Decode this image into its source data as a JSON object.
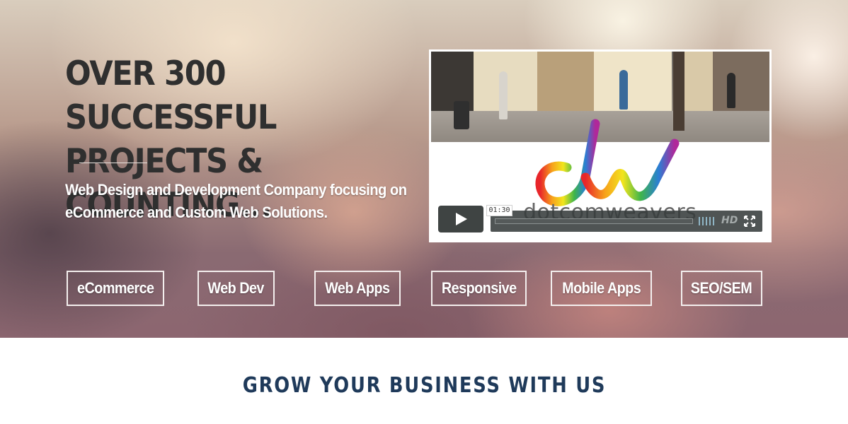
{
  "hero": {
    "headline": "OVER 300 SUCCESSFUL PROJECTS & COUNTING...",
    "subheadline": "Web Design and Development Company focusing on eCommerce and Custom Web Solutions."
  },
  "video": {
    "time": "01:30",
    "hd_label": "HD",
    "progress_percent": 0,
    "brand_word": "dotcomweavers",
    "icons": [
      "play-icon",
      "volume-icon",
      "hd-icon",
      "fullscreen-icon"
    ]
  },
  "services": [
    {
      "label": "eCommerce"
    },
    {
      "label": "Web Dev"
    },
    {
      "label": "Web Apps"
    },
    {
      "label": "Responsive"
    },
    {
      "label": "Mobile Apps"
    },
    {
      "label": "SEO/SEM"
    }
  ],
  "section": {
    "title": "GROW YOUR BUSINESS WITH US"
  },
  "colors": {
    "headline": "#2f2f2f",
    "section_title": "#1f3a5a",
    "button_border": "#f4efee"
  }
}
